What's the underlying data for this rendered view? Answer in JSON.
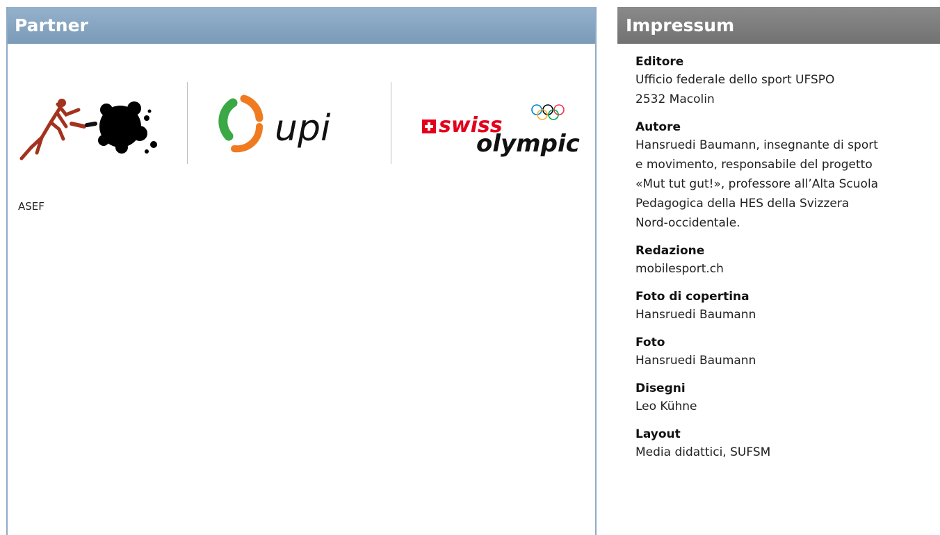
{
  "partner": {
    "title": "Partner",
    "caption": "ASEF",
    "logos": {
      "upi_text": "upi",
      "swiss_text": "swiss",
      "olympic_text": "olympic"
    }
  },
  "impressum": {
    "title": "Impressum",
    "sections": [
      {
        "heading": "Editore",
        "text": "Ufficio federale dello sport UFSPO\n2532 Macolin"
      },
      {
        "heading": "Autore",
        "text": "Hansruedi Baumann, insegnante di sport\ne movimento, responsabile del progetto\n«Mut tut gut!», professore all’Alta Scuola\nPedagogica della HES della Svizzera\nNord-occidentale."
      },
      {
        "heading": "Redazione",
        "text": "mobilesport.ch"
      },
      {
        "heading": "Foto di copertina",
        "text": "Hansruedi Baumann"
      },
      {
        "heading": "Foto",
        "text": "Hansruedi Baumann"
      },
      {
        "heading": "Disegni",
        "text": "Leo Kühne"
      },
      {
        "heading": "Layout",
        "text": "Media didattici, SUFSM"
      }
    ]
  },
  "colors": {
    "partner_header": "#8aa8c4",
    "impressum_header": "#7d7d7d",
    "asef_red": "#a3321e",
    "upi_green": "#3aa845",
    "upi_orange": "#f07a1f",
    "swiss_red": "#e3001b"
  }
}
